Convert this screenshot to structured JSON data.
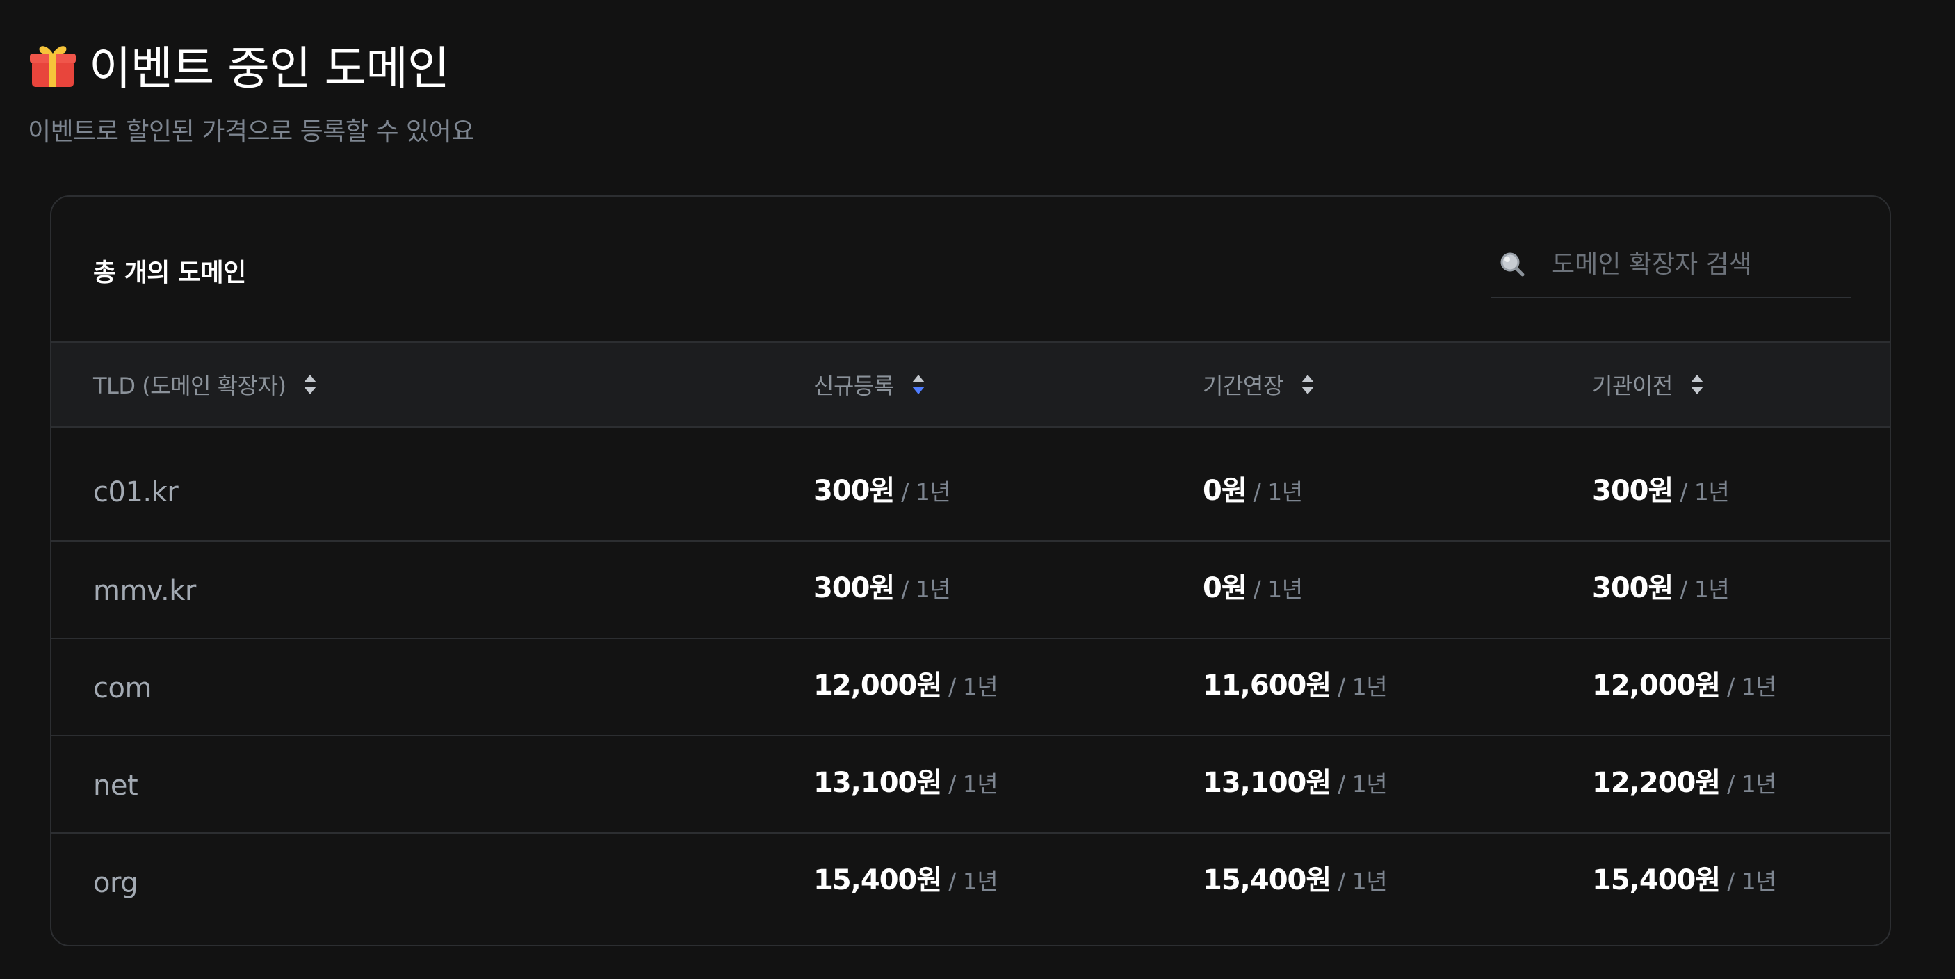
{
  "header": {
    "title": "이벤트 중인 도메인",
    "subtitle": "이벤트로 할인된 가격으로 등록할 수 있어요",
    "icon": "gift-icon"
  },
  "card": {
    "total_label": "총 개의 도메인",
    "search": {
      "placeholder": "도메인 확장자 검색",
      "value": "",
      "icon": "search-icon"
    }
  },
  "table": {
    "columns": [
      {
        "label": "TLD (도메인 확장자)",
        "sort": "none"
      },
      {
        "label": "신규등록",
        "sort": "active"
      },
      {
        "label": "기간연장",
        "sort": "none"
      },
      {
        "label": "기관이전",
        "sort": "none"
      }
    ],
    "rows": [
      {
        "tld": "c01.kr",
        "register": "300원",
        "renew": "0원",
        "transfer": "300원"
      },
      {
        "tld": "mmv.kr",
        "register": "300원",
        "renew": "0원",
        "transfer": "300원"
      },
      {
        "tld": "com",
        "register": "12,000원",
        "renew": "11,600원",
        "transfer": "12,000원"
      },
      {
        "tld": "net",
        "register": "13,100원",
        "renew": "13,100원",
        "transfer": "12,200원"
      },
      {
        "tld": "org",
        "register": "15,400원",
        "renew": "15,400원",
        "transfer": "15,400원"
      }
    ],
    "period": "/ 1년"
  },
  "colors": {
    "background": "#121212",
    "accent_sort": "#4f7dff",
    "gift_red": "#e8453c",
    "gift_yellow": "#f6c43a"
  }
}
